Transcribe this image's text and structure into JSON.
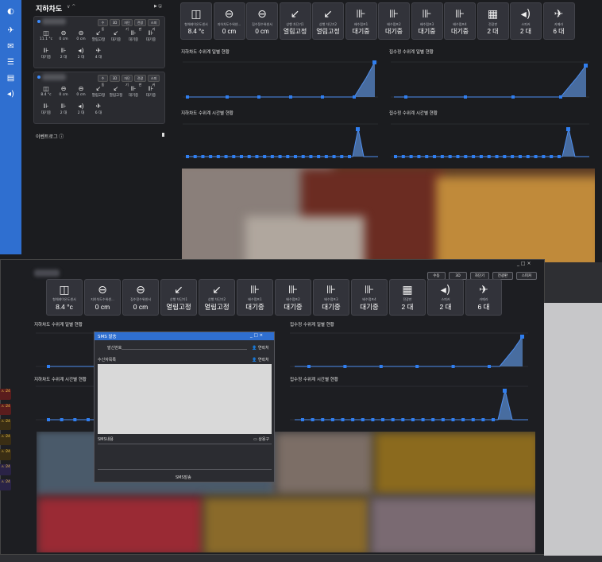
{
  "back": {
    "header_title": "지하차도",
    "header_chev": "∨ ^",
    "header_play": "▶ 🖫",
    "site1": {
      "btns": [
        "수동",
        "3D",
        "자단기",
        "전광판",
        "스피커"
      ]
    },
    "site1_cells_r1": [
      [
        "◫",
        "11.1 °c"
      ],
      [
        "⊖",
        "0 cm"
      ],
      [
        "⊖",
        "0 cm"
      ],
      [
        "↙",
        "열림고정"
      ],
      [
        "↙",
        "대기중"
      ],
      [
        "⊪",
        "대기중"
      ],
      [
        "⊪",
        "대기중"
      ]
    ],
    "site1_cells_r2": [
      [
        "⊪",
        "대기중"
      ],
      [
        "⊪",
        "2 대"
      ],
      [
        "◂)",
        "2 대"
      ],
      [
        "✈",
        "4 대"
      ]
    ],
    "site2": {
      "btns": [
        "수동",
        "3D",
        "자단기",
        "전광판",
        "스피커"
      ]
    },
    "site2_cells_r1": [
      [
        "◫",
        "8.4 °c"
      ],
      [
        "⊖",
        "0 cm"
      ],
      [
        "⊖",
        "0 cm"
      ],
      [
        "↙",
        "열림고정"
      ],
      [
        "↙",
        "열림고정"
      ],
      [
        "⊪",
        "대기중"
      ],
      [
        "⊪",
        "대기중"
      ]
    ],
    "site2_cells_r2": [
      [
        "⊪",
        "대기중"
      ],
      [
        "⊪",
        "2 대"
      ],
      [
        "◂)",
        "2 대"
      ],
      [
        "✈",
        "6 대"
      ]
    ],
    "event_log": "이벤트로그 ⓘ",
    "tiles": [
      {
        "icon": "◫",
        "label": "형체레이온도센서",
        "value": "8.4 °c"
      },
      {
        "icon": "⊖",
        "label": "지하차도수위센...",
        "value": "0 cm"
      },
      {
        "icon": "⊖",
        "label": "집수정수위센서",
        "value": "0 cm"
      },
      {
        "icon": "↙",
        "label": "상행 차단기1",
        "value": "열림고정"
      },
      {
        "icon": "↙",
        "label": "상행 차단기2",
        "value": "열림고정"
      },
      {
        "icon": "⊪",
        "label": "배수펌프1",
        "value": "대기중"
      },
      {
        "icon": "⊪",
        "label": "배수펌프2",
        "value": "대기중"
      },
      {
        "icon": "⊪",
        "label": "배수펌프3",
        "value": "대기중"
      },
      {
        "icon": "⊪",
        "label": "배수펌프4",
        "value": "대기중"
      },
      {
        "icon": "▦",
        "label": "전광판",
        "value": "2 대"
      },
      {
        "icon": "◂)",
        "label": "스피커",
        "value": "2 대"
      },
      {
        "icon": "✈",
        "label": "카메라",
        "value": "6 대"
      }
    ],
    "chart_titles": [
      "지하차도 수위계 일별 현황",
      "집수정 수위계 일별 현황",
      "지하차도 수위계 시간별 현황",
      "집수정 수위계 시간별 현황"
    ]
  },
  "front": {
    "window_ctrls": "_ □ ×",
    "buttons": [
      "수동",
      "3D",
      "자단기",
      "전광판",
      "스피커"
    ],
    "tiles": [
      {
        "icon": "◫",
        "label": "형체레이온도센서",
        "value": "8.4 °c"
      },
      {
        "icon": "⊖",
        "label": "지하차도수위센...",
        "value": "0 cm"
      },
      {
        "icon": "⊖",
        "label": "집수정수위센서",
        "value": "0 cm"
      },
      {
        "icon": "↙",
        "label": "상행 차단기1",
        "value": "열림고정"
      },
      {
        "icon": "↙",
        "label": "상행 차단기2",
        "value": "열림고정"
      },
      {
        "icon": "⊪",
        "label": "배수펌프1",
        "value": "대기중"
      },
      {
        "icon": "⊪",
        "label": "배수펌프2",
        "value": "대기중"
      },
      {
        "icon": "⊪",
        "label": "배수펌프3",
        "value": "대기중"
      },
      {
        "icon": "⊪",
        "label": "배수펌프4",
        "value": "대기중"
      },
      {
        "icon": "▦",
        "label": "전광판",
        "value": "2 대"
      },
      {
        "icon": "◂)",
        "label": "스피커",
        "value": "2 대"
      },
      {
        "icon": "✈",
        "label": "카메라",
        "value": "6 대"
      }
    ],
    "chart_titles": [
      "지하차도 수위계 일별 현황",
      "집수정 수위계 일별 현황",
      "지하차도 수위계 시간별 현황",
      "집수정 수위계 시간별 현황"
    ]
  },
  "sms": {
    "title": "SMS 발송",
    "ctrls": "_ □ ×",
    "sender_label": "발신번호",
    "recipients_label": "수신자목록",
    "contact_btn": "👤 연락처",
    "content_label": "SMS내용",
    "template_btn": "▭ 상용구",
    "send_btn": "SMS발송"
  },
  "events": [
    "⚠ :24",
    "⚠ :24",
    "⚠ :24",
    "⚠ :24",
    "⚠ :24",
    "⚠ :24",
    "⚠ :24"
  ],
  "left_stub": {
    "a": "⊪ 기중",
    "b": "⊪ 기중",
    "c": "▸ 🖫"
  }
}
